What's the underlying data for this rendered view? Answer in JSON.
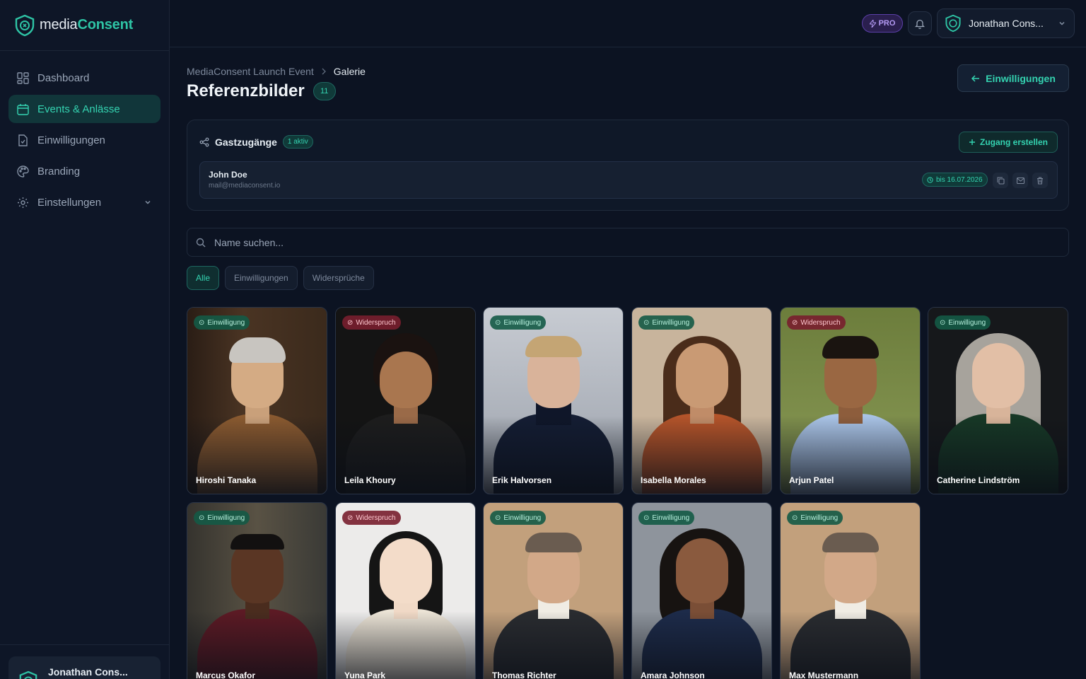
{
  "app": {
    "brand_part1": "media",
    "brand_part2": "Consent"
  },
  "sidebar": {
    "items": [
      {
        "label": "Dashboard",
        "icon": "dashboard-icon"
      },
      {
        "label": "Events & Anlässe",
        "icon": "calendar-icon"
      },
      {
        "label": "Einwilligungen",
        "icon": "file-check-icon"
      },
      {
        "label": "Branding",
        "icon": "palette-icon"
      },
      {
        "label": "Einstellungen",
        "icon": "gear-icon"
      }
    ],
    "user_name": "Jonathan Cons..."
  },
  "topbar": {
    "pro_label": "PRO",
    "account_name": "Jonathan Cons..."
  },
  "breadcrumb": {
    "parent": "MediaConsent Launch Event",
    "current": "Galerie"
  },
  "page": {
    "title": "Referenzbilder",
    "count": "11",
    "back_label": "Einwilligungen"
  },
  "guest_access": {
    "title": "Gastzugänge",
    "active_badge": "1 aktiv",
    "create_label": "Zugang erstellen",
    "guest": {
      "name": "John Doe",
      "email": "mail@mediaconsent.io",
      "expiry": "bis 16.07.2026"
    }
  },
  "search": {
    "placeholder": "Name suchen..."
  },
  "filters": [
    "Alle",
    "Einwilligungen",
    "Widersprüche"
  ],
  "status_labels": {
    "consent": "Einwilligung",
    "objection": "Widerspruch"
  },
  "colors": {
    "accent": "#34d3b1",
    "background": "#0c1322",
    "pro": "#b59bf5",
    "consent": "#145a46",
    "objection": "#781e2d"
  },
  "gallery": [
    {
      "name": "Hiroshi Tanaka",
      "status": "Einwilligung"
    },
    {
      "name": "Leila Khoury",
      "status": "Widerspruch"
    },
    {
      "name": "Erik Halvorsen",
      "status": "Einwilligung"
    },
    {
      "name": "Isabella Morales",
      "status": "Einwilligung"
    },
    {
      "name": "Arjun Patel",
      "status": "Widerspruch"
    },
    {
      "name": "Catherine Lindström",
      "status": "Einwilligung"
    },
    {
      "name": "Marcus Okafor",
      "status": "Einwilligung"
    },
    {
      "name": "Yuna Park",
      "status": "Widerspruch"
    },
    {
      "name": "Thomas Richter",
      "status": "Einwilligung"
    },
    {
      "name": "Amara Johnson",
      "status": "Einwilligung"
    },
    {
      "name": "Max Mustermann",
      "status": "Einwilligung"
    }
  ]
}
